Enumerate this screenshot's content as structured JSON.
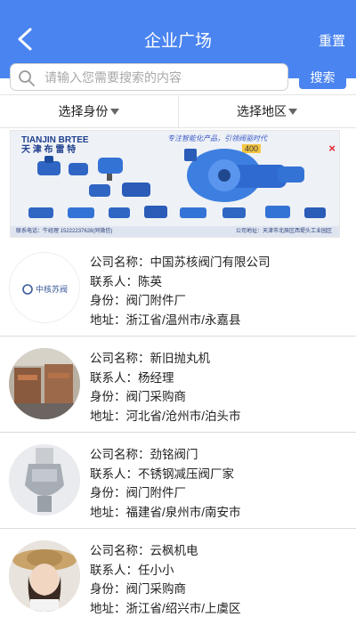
{
  "header": {
    "title": "企业广场",
    "reset_label": "重置"
  },
  "search": {
    "placeholder": "请输入您需要搜索的内容",
    "value": "",
    "button_label": "搜索"
  },
  "filters": {
    "identity_label": "选择身份",
    "region_label": "选择地区"
  },
  "banner": {
    "brand_en": "TIANJIN BRTEE",
    "brand_cn": "天 津 布 雷 特",
    "slogan": "专注智能化产品，引领阀驱时代",
    "badge": "400",
    "close_glyph": "×",
    "footer_left": "联系电话：牛经理 15222237628(同微信)",
    "footer_right": "公司地址：天津市北辰区西堤头工业园区"
  },
  "labels": {
    "company": "公司名称：",
    "contact": "联系人：",
    "identity": "身份：",
    "address": "地址："
  },
  "companies": [
    {
      "name": "中国苏核阀门有限公司",
      "contact": "陈英",
      "identity": "阀门附件厂",
      "address": "浙江省/温州市/永嘉县",
      "logo_text": "中核苏阀"
    },
    {
      "name": "新旧抛丸机",
      "contact": "杨经理",
      "identity": "阀门采购商",
      "address": "河北省/沧州市/泊头市"
    },
    {
      "name": "劲铭阀门",
      "contact": "不锈钢减压阀厂家",
      "identity": "阀门附件厂",
      "address": "福建省/泉州市/南安市"
    },
    {
      "name": "云枫机电",
      "contact": "任小小",
      "identity": "阀门采购商",
      "address": "浙江省/绍兴市/上虞区"
    }
  ],
  "colors": {
    "primary": "#4a84f0"
  }
}
